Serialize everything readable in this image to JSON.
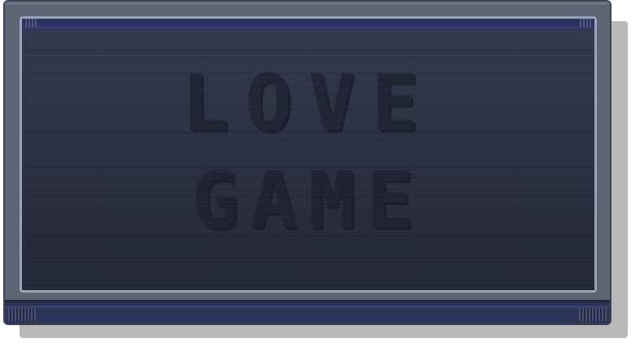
{
  "game": {
    "title_line_1": "LOVE",
    "title_line_2": "GAME"
  },
  "colors": {
    "frame": "#5d6474",
    "frame_border": "#3d4352",
    "screen_border": "#9aa3bb",
    "screen_bg_top": "#343a4f",
    "screen_bg_bottom": "#242938",
    "base": "#2d3356",
    "title_text": "#1f2331",
    "shadow": "#b9b9b9"
  }
}
